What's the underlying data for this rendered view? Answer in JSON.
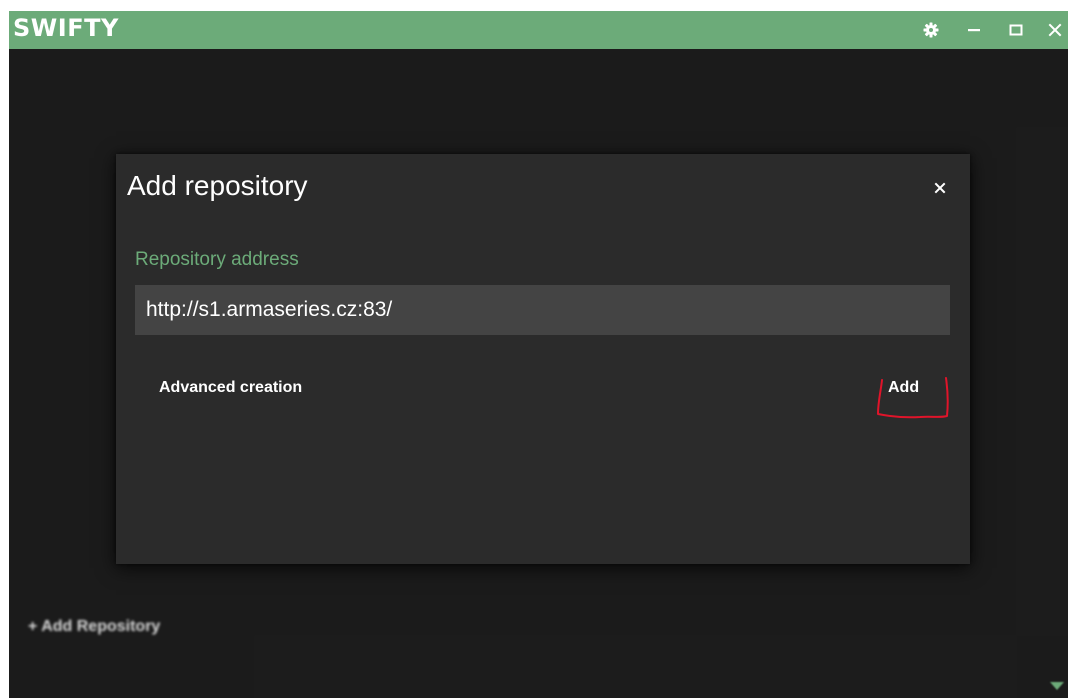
{
  "app": {
    "title": "SWIFTY",
    "accent_color": "#6cab79",
    "window_controls": [
      {
        "name": "settings",
        "icon": "gear-icon"
      },
      {
        "name": "minimize",
        "icon": "minimize-icon"
      },
      {
        "name": "maximize",
        "icon": "maximize-icon"
      },
      {
        "name": "close",
        "icon": "close-icon"
      }
    ]
  },
  "background": {
    "add_repository_label": "+ Add Repository"
  },
  "dialog": {
    "title": "Add repository",
    "close_icon": "close-icon",
    "field_label": "Repository address",
    "address_value": "http://s1.armaseries.cz:83/",
    "advanced_label": "Advanced creation",
    "add_label": "Add",
    "annotation": "red-hand-drawn-bracket-around-add-button"
  }
}
